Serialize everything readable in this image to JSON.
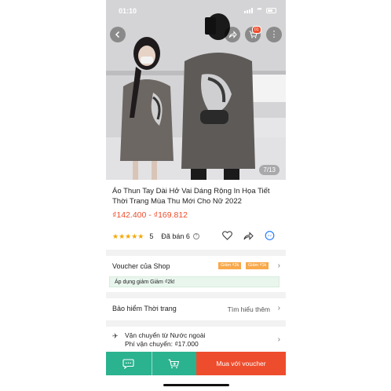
{
  "status_bar": {
    "time": "01:10"
  },
  "header": {
    "back_icon": "chevron-left-icon",
    "share_icon": "share-icon",
    "cart_icon": "cart-icon",
    "cart_badge": "01",
    "more_icon": "more-vertical-icon"
  },
  "gallery": {
    "counter": "7/13"
  },
  "product": {
    "title": "Áo Thun Tay Dài Hở Vai Dáng Rộng In Họa Tiết Thời Trang Mùa Thu Mới Cho Nữ 2022",
    "price": "₫142.400 - ₫169.812",
    "rating_value": "5",
    "stars": 5,
    "sold": "Đã bán 6"
  },
  "voucher": {
    "label": "Voucher của Shop",
    "tags": [
      "Giảm ₫2k",
      "Giảm ₫1k"
    ],
    "note": "Áp dụng giảm Giảm ₫2k!"
  },
  "insurance": {
    "label": "Bảo hiểm Thời trang",
    "more": "Tìm hiểu thêm"
  },
  "shipping": {
    "line1": "Vận chuyển từ Nước ngoài",
    "line2": "Phí vận chuyển: ₫17.000"
  },
  "bottom_bar": {
    "buy_label": "Mua với voucher"
  },
  "colors": {
    "accent": "#ee4d2d",
    "green": "#2bb28f",
    "star": "#f6a700"
  }
}
